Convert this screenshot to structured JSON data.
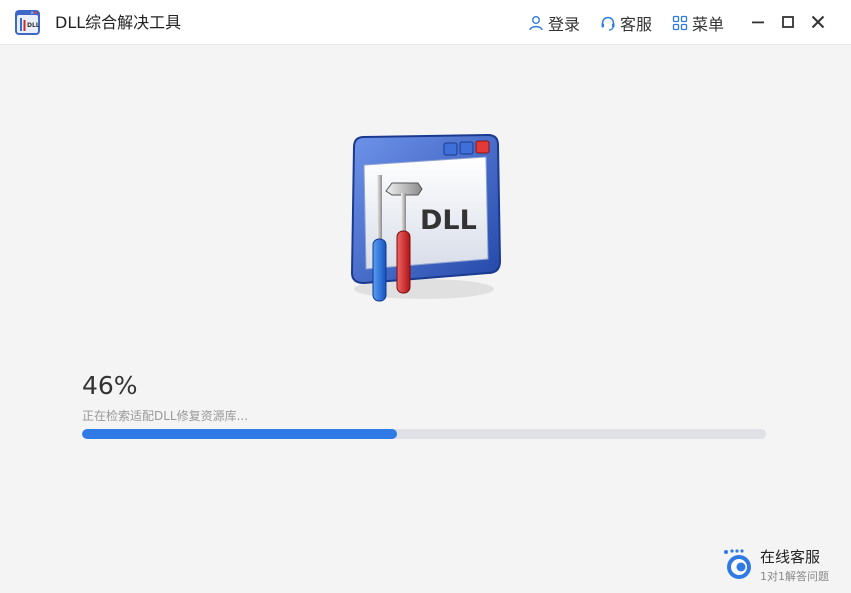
{
  "window": {
    "title": "DLL综合解决工具"
  },
  "titlebar": {
    "login_label": "登录",
    "service_label": "客服",
    "menu_label": "菜单",
    "icons": [
      "user-icon",
      "headset-icon",
      "grid-menu-icon",
      "minimize-icon",
      "maximize-icon",
      "close-icon"
    ]
  },
  "hero": {
    "logo_text": "DLL"
  },
  "progress": {
    "percent_text": "46%",
    "value": 46,
    "status_text": "正在检索适配DLL修复资源库..."
  },
  "support": {
    "title": "在线客服",
    "subtitle": "1对1解答问题"
  },
  "colors": {
    "accent": "#2f7ae5",
    "track": "#dfe1e6",
    "background": "#f4f4f5",
    "titlebar": "#ffffff"
  }
}
